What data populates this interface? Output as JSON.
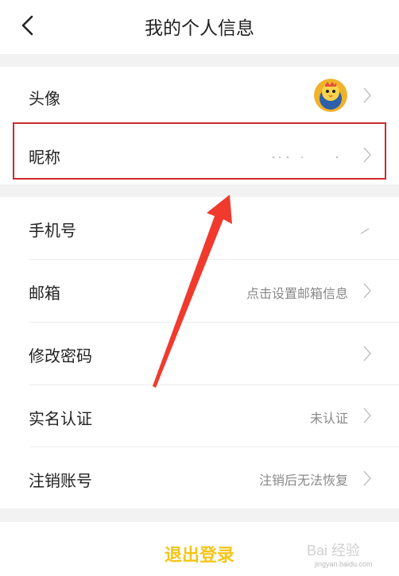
{
  "header": {
    "title": "我的个人信息"
  },
  "rows": [
    {
      "label": "头像",
      "value": ""
    },
    {
      "label": "昵称",
      "value": ""
    },
    {
      "label": "手机号",
      "value": ""
    },
    {
      "label": "邮箱",
      "value": "点击设置邮箱信息"
    },
    {
      "label": "修改密码",
      "value": ""
    },
    {
      "label": "实名认证",
      "value": "未认证"
    },
    {
      "label": "注销账号",
      "value": "注销后无法恢复"
    }
  ],
  "logout": {
    "label": "退出登录"
  },
  "watermark": {
    "text": "Bai 经验",
    "sub": "jingyan.baidu.com"
  },
  "colors": {
    "accent": "#f5c518",
    "highlight": "#cc2b2b",
    "arrow": "#f03a2e"
  }
}
